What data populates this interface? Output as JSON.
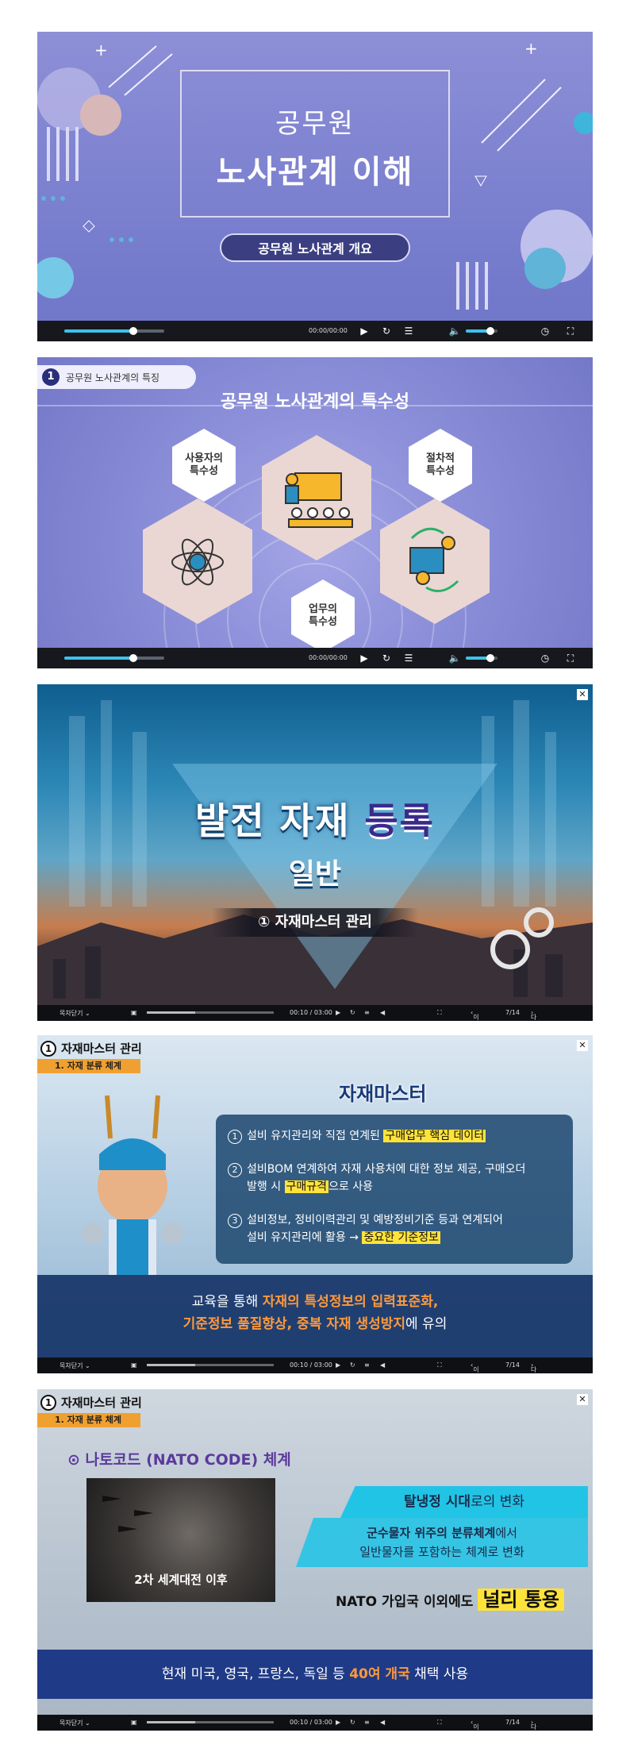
{
  "slide1": {
    "title_line1": "공무원",
    "title_line2": "노사관계 이해",
    "subtitle": "공무원 노사관계 개요",
    "player": {
      "time": "00:00/00:00",
      "progress": 0.68,
      "volume": 0.75
    }
  },
  "slide2": {
    "section_number": "1",
    "section_label": "공무원 노사관계의 특징",
    "title": "공무원 노사관계의 특수성",
    "labels": [
      "사용자의\n특수성",
      "절차적\n특수성",
      "업무의\n특수성"
    ],
    "player": {
      "time": "00:00/00:00",
      "progress": 0.68,
      "volume": 0.75
    }
  },
  "slide3": {
    "title_part1": "발전 자재 ",
    "title_part2": "등록",
    "title_line2": "일반",
    "band": "① 자재마스터 관리",
    "close": "✕",
    "player": {
      "menu": "목차닫기 ⌄",
      "time": "00:10 / 03:00",
      "page_prev": "이전",
      "page": "7/14",
      "page_next": "다음"
    }
  },
  "slide4": {
    "section_number": "1",
    "section_title": "자재마스터 관리",
    "sub": "1. 자재 분류 체계",
    "box_title": "자재마스터",
    "items": [
      {
        "n": "1",
        "pre": "설비 유지관리와 직접 연계된 ",
        "hl": "구매업무 핵심 데이터",
        "post": ""
      },
      {
        "n": "2",
        "pre": "설비BOM 연계하여 자재 사용처에 대한 정보 제공, 구매오더",
        "line2_pre": "발행 시 ",
        "hl": "구매규격",
        "post": "으로 사용"
      },
      {
        "n": "3",
        "pre": "설비정보, 정비이력관리 및 예방정비기준 등과 연계되어",
        "line2_pre": "설비 유지관리에 활용 → ",
        "hl": "중요한 기준정보",
        "post": ""
      }
    ],
    "bottom_line1_pre": "교육을 통해 ",
    "bottom_line1_em": "자재의 특성정보의 입력표준화,",
    "bottom_line2_em": "기준정보 품질향상, 중복 자재 생성방지",
    "bottom_line2_post": "에 유의",
    "close": "✕",
    "player": {
      "menu": "목차닫기 ⌄",
      "time": "00:10 / 03:00",
      "page_prev": "이전",
      "page": "7/14",
      "page_next": "다음"
    }
  },
  "slide5": {
    "section_number": "1",
    "section_title": "자재마스터 관리",
    "sub": "1. 자재 분류 체계",
    "nato_title": "나토코드 (NATO CODE) 체계",
    "photo_caption": "2차 세계대전 이후",
    "banner1_bold": "탈냉정 시대",
    "banner1_post": "로의 변화",
    "banner2_line1_bold": "군수물자 위주의 분류체계",
    "banner2_line1_post": "에서",
    "banner2_line2": "일반물자를 포함하는 체계로 변화",
    "nato_pre": "NATO 가입국 이외에도 ",
    "nato_hl": "널리 통용",
    "bottom_pre": "현재 미국, 영국, 프랑스, 독일 등 ",
    "bottom_em": "40여 개국",
    "bottom_post": " 채택 사용",
    "close": "✕",
    "player": {
      "menu": "목차닫기 ⌄",
      "time": "00:10 / 03:00",
      "page_prev": "이전",
      "page": "7/14",
      "page_next": "다음"
    }
  },
  "colors": {
    "accent": "#3ec0ea",
    "highlight": "#ffe33a",
    "orange": "#ff9a3c",
    "navy": "#1f3a86"
  }
}
